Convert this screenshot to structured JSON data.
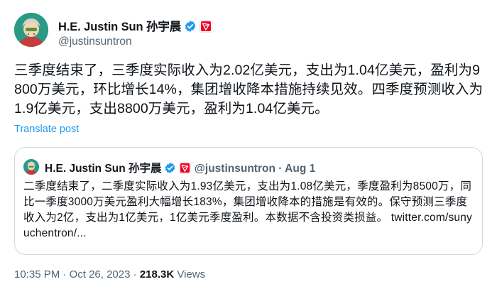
{
  "author": {
    "display_name": "H.E. Justin Sun 孙宇晨",
    "handle": "@justinsuntron",
    "verified_badge_icon": "verified-badge-icon",
    "affiliate_icon": "tron-logo-icon"
  },
  "tweet": {
    "text": "三季度结束了，三季度实际收入为2.02亿美元，支出为1.04亿美元，盈利为9800万美元，环比增长14%，集团增收降本措施持续见效。四季度预测收入为1.9亿美元，支出8800万美元，盈利为1.04亿美元。",
    "translate_label": "Translate post"
  },
  "quoted": {
    "display_name": "H.E. Justin Sun 孙宇晨",
    "handle": "@justinsuntron",
    "separator": "·",
    "date": "Aug 1",
    "text": "二季度结束了，二季度实际收入为1.93亿美元，支出为1.08亿美元，季度盈利为8500万，同比一季度3000万美元盈利大幅增长183%，集团增收降本的措施是有效的。保守预测三季度收入为2亿，支出为1亿美元，1亿美元季度盈利。本数据不含投资类损益。",
    "link": "twitter.com/sunyuchentron/..."
  },
  "footer": {
    "time": "10:35 PM",
    "separator1": "·",
    "date": "Oct 26, 2023",
    "separator2": "·",
    "views_count": "218.3K",
    "views_label": "Views"
  },
  "colors": {
    "link_blue": "#1d9bf0",
    "muted_gray": "#536471",
    "border": "#cfd9de",
    "tron_red": "#ef0027"
  }
}
